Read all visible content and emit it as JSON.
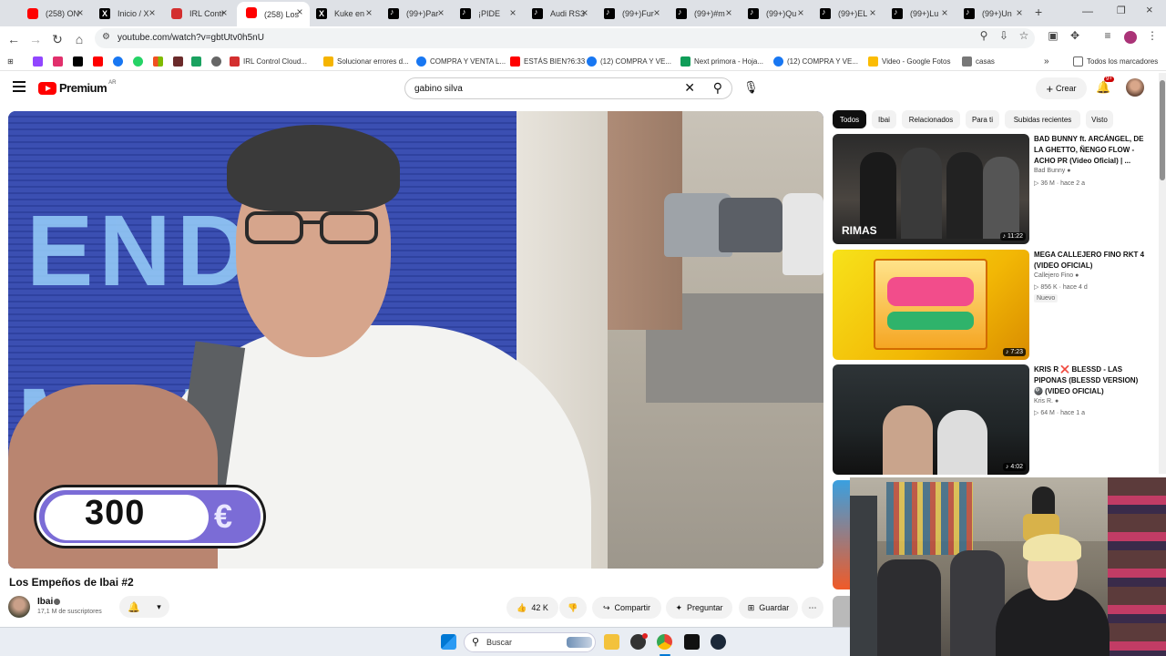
{
  "browser": {
    "tabs": [
      {
        "title": "(258) ON",
        "favicon": "youtube-icon"
      },
      {
        "title": "Inicio / X",
        "favicon": "x-icon"
      },
      {
        "title": "IRL Contr",
        "favicon": "irl-icon"
      },
      {
        "title": "(258) Los",
        "favicon": "youtube-icon",
        "active": true
      },
      {
        "title": "Kuke en",
        "favicon": "x-icon"
      },
      {
        "title": "(99+)Par",
        "favicon": "tiktok-icon"
      },
      {
        "title": "¡PIDE",
        "favicon": "tiktok-icon"
      },
      {
        "title": "Audi RS3",
        "favicon": "tiktok-icon"
      },
      {
        "title": "(99+)Fur",
        "favicon": "tiktok-icon"
      },
      {
        "title": "(99+)#m",
        "favicon": "tiktok-icon"
      },
      {
        "title": "(99+)Qu",
        "favicon": "tiktok-icon"
      },
      {
        "title": "(99+)EL",
        "favicon": "tiktok-icon"
      },
      {
        "title": "(99+)Lu",
        "favicon": "tiktok-icon"
      },
      {
        "title": "(99+)Un",
        "favicon": "tiktok-icon"
      }
    ],
    "new_tab": "+",
    "url": "youtube.com/watch?v=gbtUtv0h5nU",
    "bookmarks": [
      {
        "label": "IRL Control Cloud...",
        "color": "#d32f2f"
      },
      {
        "label": "Solucionar errores d...",
        "color": "#f5b400"
      },
      {
        "label": "COMPRA Y VENTA L...",
        "color": "#1877f2"
      },
      {
        "label": "ESTÁS BIEN?6:33",
        "color": "#ff0000"
      },
      {
        "label": "(12) COMPRA Y VE...",
        "color": "#1877f2"
      },
      {
        "label": "Next primora - Hoja...",
        "color": "#0f9d58"
      },
      {
        "label": "(12) COMPRA Y VE...",
        "color": "#1877f2"
      },
      {
        "label": "Video - Google Fotos",
        "color": "#fbbc04"
      },
      {
        "label": "casas",
        "color": "#666666"
      }
    ],
    "bookmarks_more": "»",
    "all_bookmarks": "Todos los marcadores"
  },
  "youtube": {
    "logo_text": "Premium",
    "country": "AR",
    "search_value": "gabino silva",
    "create_label": "Crear",
    "notif_count": "9+",
    "video": {
      "price_number": "300",
      "price_currency": "€",
      "title": "Los Empeños de Ibai #2",
      "channel": "Ibai",
      "subscribers": "17,1 M de suscriptores",
      "likes": "42 K",
      "share_label": "Compartir",
      "ask_label": "Preguntar",
      "save_label": "Guardar"
    },
    "chips": [
      "Todos",
      "Ibai",
      "Relacionados",
      "Para ti",
      "Subidas recientes",
      "Visto"
    ],
    "related": [
      {
        "title": "BAD BUNNY ft. ARCÁNGEL, DE LA GHETTO, ÑENGO FLOW - ACHO PR (Video Oficial) | ...",
        "channel": "Bad Bunny",
        "views": "36 M",
        "age": "hace 2 a",
        "duration": "11:22",
        "thumb_label": "RIMAS"
      },
      {
        "title": "MEGA CALLEJERO FINO RKT 4 (VIDEO OFICIAL)",
        "channel": "Callejero Fino",
        "views": "856 K",
        "age": "hace 4 d",
        "duration": "7:23",
        "badge": "Nuevo"
      },
      {
        "title": "KRIS R ❌ BLESSD - LAS PIPONAS (BLESSD VERSION) 🎱 (VIDEO OFICIAL)",
        "channel": "Kris R.",
        "views": "64 M",
        "age": "hace 1 a",
        "duration": "4:02"
      }
    ]
  },
  "taskbar": {
    "search_label": "Buscar"
  },
  "colors": {
    "yt_red": "#ff0000",
    "price_purple": "#7b6cd6",
    "chip_active": "#0f0f0f"
  }
}
